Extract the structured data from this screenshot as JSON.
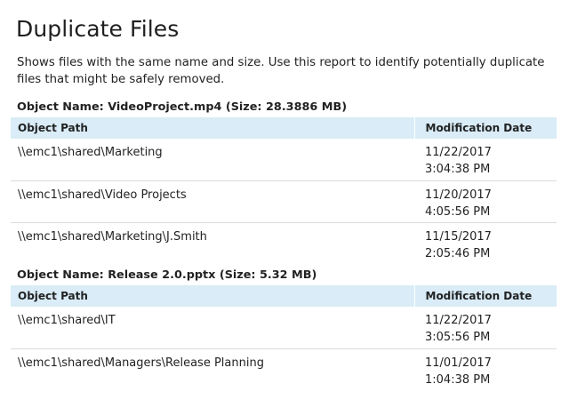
{
  "report": {
    "title": "Duplicate Files",
    "description": "Shows files with the same name and size. Use this report to identify potentially duplicate files that might be safely removed."
  },
  "columns": {
    "path": "Object Path",
    "date": "Modification Date"
  },
  "groups": [
    {
      "header": "Object Name: VideoProject.mp4 (Size: 28.3886 MB)",
      "rows": [
        {
          "path": "\\\\emc1\\shared\\Marketing",
          "date": "11/22/2017",
          "time": "3:04:38 PM"
        },
        {
          "path": "\\\\emc1\\shared\\Video Projects",
          "date": "11/20/2017",
          "time": "4:05:56 PM"
        },
        {
          "path": "\\\\emc1\\shared\\Marketing\\J.Smith",
          "date": "11/15/2017",
          "time": "2:05:46 PM"
        }
      ]
    },
    {
      "header": "Object Name: Release 2.0.pptx (Size: 5.32 MB)",
      "rows": [
        {
          "path": "\\\\emc1\\shared\\IT",
          "date": "11/22/2017",
          "time": "3:05:56 PM"
        },
        {
          "path": "\\\\emc1\\shared\\Managers\\Release Planning",
          "date": "11/01/2017",
          "time": "1:04:38 PM"
        }
      ]
    }
  ]
}
